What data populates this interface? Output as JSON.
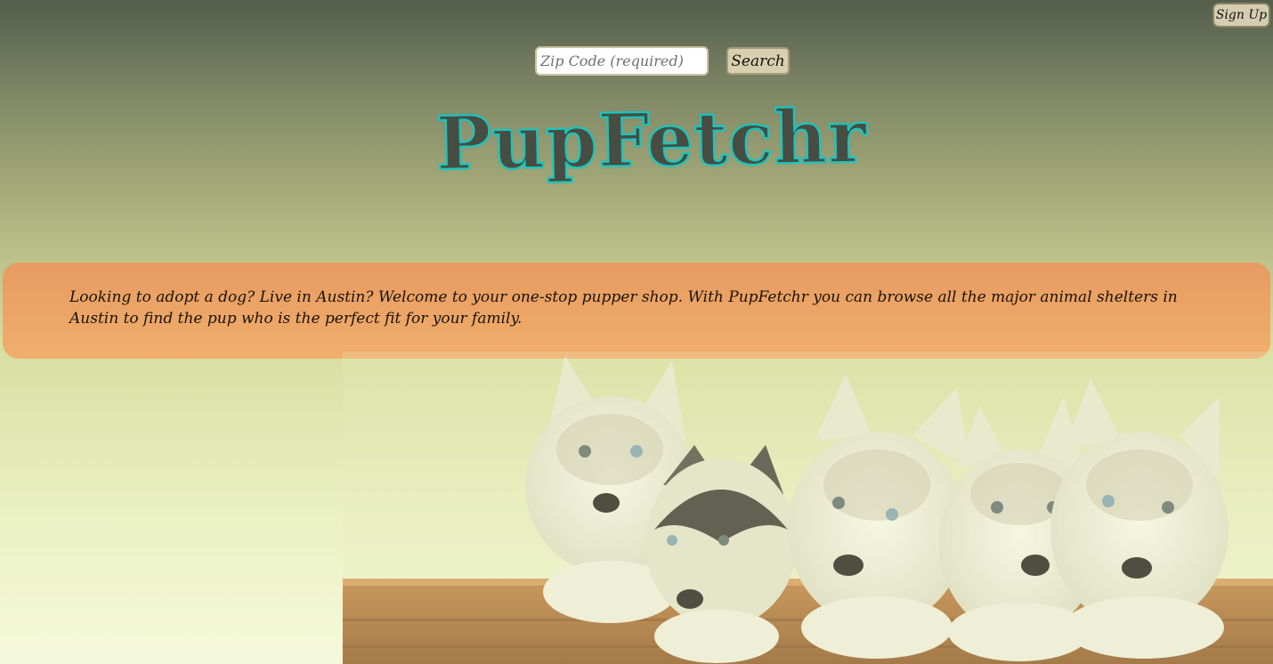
{
  "header": {
    "signup_label": "Sign Up"
  },
  "search": {
    "placeholder": "Zip Code (required)",
    "button_label": "Search"
  },
  "brand": {
    "logo_text": "PupFetchr"
  },
  "intro": {
    "text": "Looking to adopt a dog? Live in Austin? Welcome to your one-stop pupper shop. With PupFetchr you can browse all the major animal shelters in Austin to find the pup who is the perfect fit for your family."
  },
  "colors": {
    "banner": "#eca466",
    "logo_fill": "#474d42",
    "logo_outline": "#16c7c2",
    "button": "#d8cfae"
  },
  "hero": {
    "image_name": "husky-puppies-photo"
  }
}
